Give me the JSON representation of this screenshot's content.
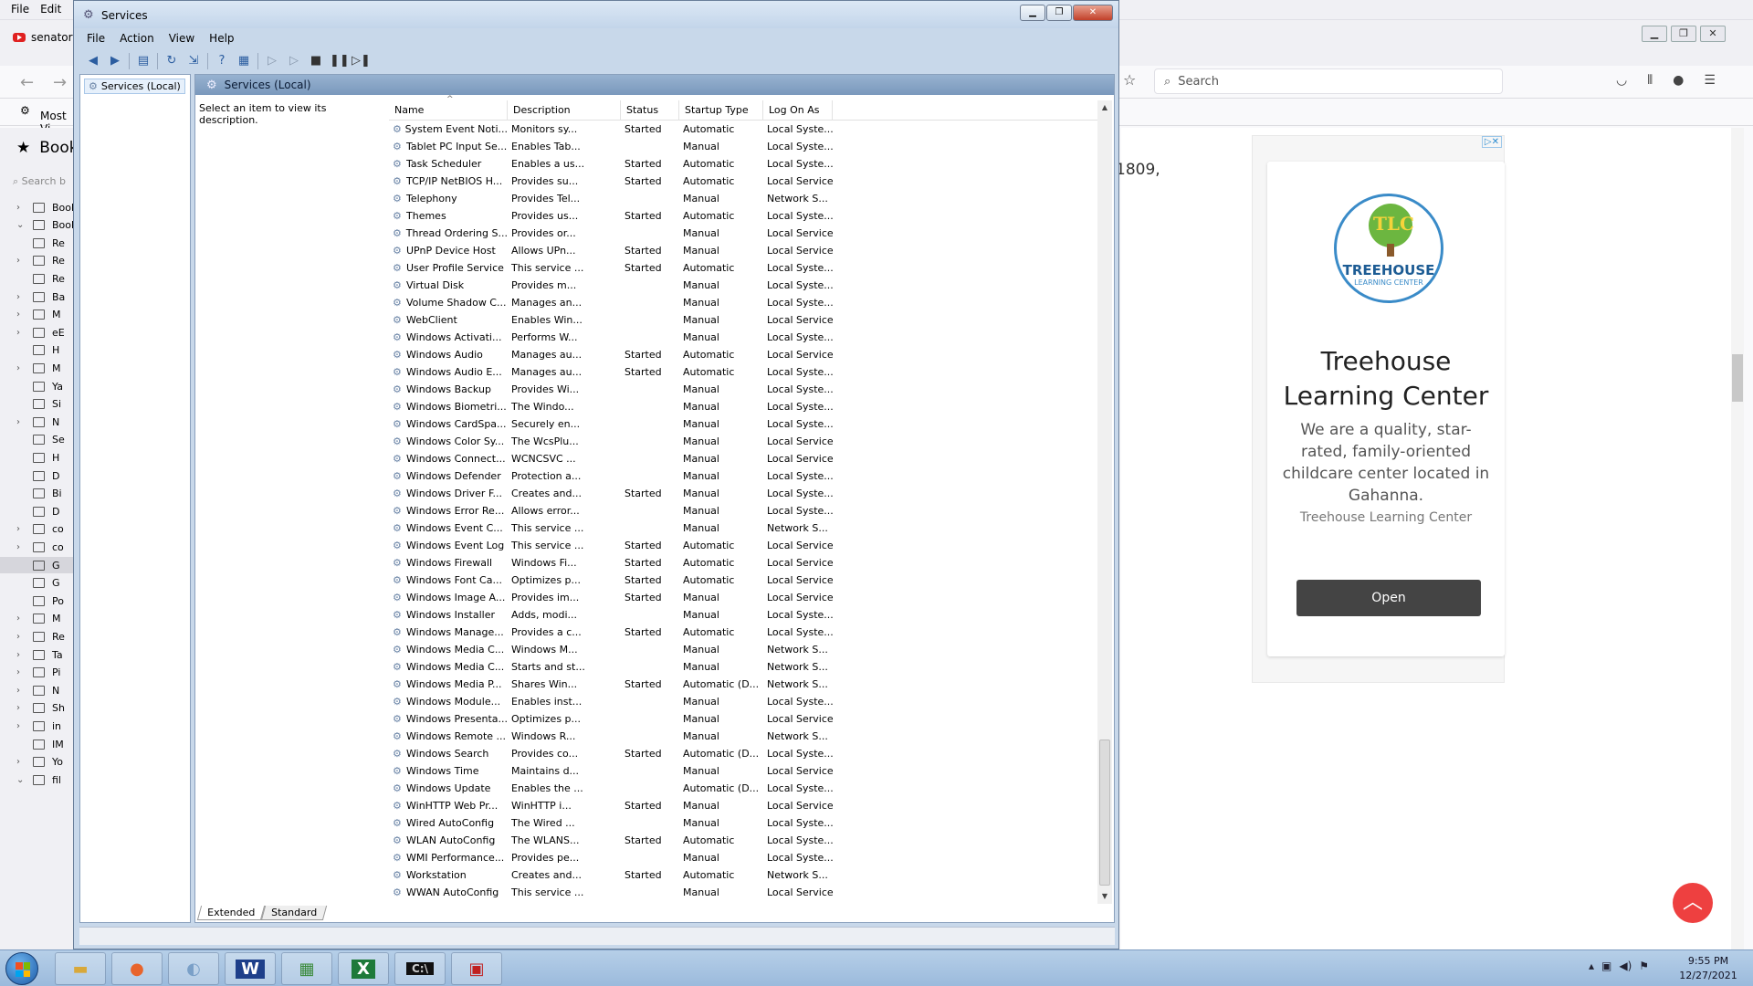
{
  "browser": {
    "menu": [
      "File",
      "Edit"
    ],
    "tab_title": "senator",
    "search_placeholder": "Search",
    "bookmarks_bar_label": "Most Vi",
    "sidebar_title": "Book",
    "sidebar_search": "Search b",
    "sidebar_rows": [
      {
        "label": "Book",
        "tw": "›"
      },
      {
        "label": "Book",
        "tw": "⌄"
      },
      {
        "label": "Re",
        "tw": ""
      },
      {
        "label": "Re",
        "tw": "›"
      },
      {
        "label": "Re",
        "tw": ""
      },
      {
        "label": "Ba",
        "tw": "›"
      },
      {
        "label": "M",
        "tw": "›"
      },
      {
        "label": "eE",
        "tw": "›"
      },
      {
        "label": "H",
        "tw": ""
      },
      {
        "label": "M",
        "tw": "›"
      },
      {
        "label": "Ya",
        "tw": ""
      },
      {
        "label": "Si",
        "tw": ""
      },
      {
        "label": "N",
        "tw": "›"
      },
      {
        "label": "Se",
        "tw": ""
      },
      {
        "label": "H",
        "tw": ""
      },
      {
        "label": "D",
        "tw": ""
      },
      {
        "label": "Bi",
        "tw": ""
      },
      {
        "label": "D",
        "tw": ""
      },
      {
        "label": "co",
        "tw": "›"
      },
      {
        "label": "co",
        "tw": "›"
      },
      {
        "label": "G",
        "tw": ""
      },
      {
        "label": "G",
        "tw": ""
      },
      {
        "label": "Po",
        "tw": ""
      },
      {
        "label": "M",
        "tw": "›"
      },
      {
        "label": "Re",
        "tw": "›"
      },
      {
        "label": "Ta",
        "tw": "›"
      },
      {
        "label": "Pi",
        "tw": "›"
      },
      {
        "label": "N",
        "tw": "›"
      },
      {
        "label": "Sh",
        "tw": "›"
      },
      {
        "label": "in",
        "tw": "›"
      },
      {
        "label": "IM",
        "tw": ""
      },
      {
        "label": "Yo",
        "tw": "›"
      },
      {
        "label": "fil",
        "tw": "⌄"
      }
    ],
    "page_snippet": "1809,",
    "ad": {
      "badge": "▷✕",
      "logo_initials": "TLC",
      "logo_title": "TREEHOUSE",
      "logo_subtitle": "LEARNING CENTER",
      "headline": "Treehouse Learning Center",
      "description": "We are a quality, star-rated, family-oriented childcare center located in Gahanna.",
      "brand": "Treehouse Learning Center",
      "button": "Open"
    }
  },
  "services": {
    "title": "Services",
    "menu": [
      "File",
      "Action",
      "View",
      "Help"
    ],
    "tree_node": "Services (Local)",
    "header": "Services (Local)",
    "description_prompt": "Select an item to view its description.",
    "columns": [
      "Name",
      "Description",
      "Status",
      "Startup Type",
      "Log On As"
    ],
    "rows": [
      [
        "System Event Noti...",
        "Monitors sy...",
        "Started",
        "Automatic",
        "Local Syste..."
      ],
      [
        "Tablet PC Input Se...",
        "Enables Tab...",
        "",
        "Manual",
        "Local Syste..."
      ],
      [
        "Task Scheduler",
        "Enables a us...",
        "Started",
        "Automatic",
        "Local Syste..."
      ],
      [
        "TCP/IP NetBIOS H...",
        "Provides su...",
        "Started",
        "Automatic",
        "Local Service"
      ],
      [
        "Telephony",
        "Provides Tel...",
        "",
        "Manual",
        "Network S..."
      ],
      [
        "Themes",
        "Provides us...",
        "Started",
        "Automatic",
        "Local Syste..."
      ],
      [
        "Thread Ordering S...",
        "Provides or...",
        "",
        "Manual",
        "Local Service"
      ],
      [
        "UPnP Device Host",
        "Allows UPn...",
        "Started",
        "Manual",
        "Local Service"
      ],
      [
        "User Profile Service",
        "This service ...",
        "Started",
        "Automatic",
        "Local Syste..."
      ],
      [
        "Virtual Disk",
        "Provides m...",
        "",
        "Manual",
        "Local Syste..."
      ],
      [
        "Volume Shadow C...",
        "Manages an...",
        "",
        "Manual",
        "Local Syste..."
      ],
      [
        "WebClient",
        "Enables Win...",
        "",
        "Manual",
        "Local Service"
      ],
      [
        "Windows Activati...",
        "Performs W...",
        "",
        "Manual",
        "Local Syste..."
      ],
      [
        "Windows Audio",
        "Manages au...",
        "Started",
        "Automatic",
        "Local Service"
      ],
      [
        "Windows Audio E...",
        "Manages au...",
        "Started",
        "Automatic",
        "Local Syste..."
      ],
      [
        "Windows Backup",
        "Provides Wi...",
        "",
        "Manual",
        "Local Syste..."
      ],
      [
        "Windows Biometri...",
        "The Windo...",
        "",
        "Manual",
        "Local Syste..."
      ],
      [
        "Windows CardSpa...",
        "Securely en...",
        "",
        "Manual",
        "Local Syste..."
      ],
      [
        "Windows Color Sy...",
        "The WcsPlu...",
        "",
        "Manual",
        "Local Service"
      ],
      [
        "Windows Connect...",
        "WCNCSVC ...",
        "",
        "Manual",
        "Local Service"
      ],
      [
        "Windows Defender",
        "Protection a...",
        "",
        "Manual",
        "Local Syste..."
      ],
      [
        "Windows Driver F...",
        "Creates and...",
        "Started",
        "Manual",
        "Local Syste..."
      ],
      [
        "Windows Error Re...",
        "Allows error...",
        "",
        "Manual",
        "Local Syste..."
      ],
      [
        "Windows Event C...",
        "This service ...",
        "",
        "Manual",
        "Network S..."
      ],
      [
        "Windows Event Log",
        "This service ...",
        "Started",
        "Automatic",
        "Local Service"
      ],
      [
        "Windows Firewall",
        "Windows Fi...",
        "Started",
        "Automatic",
        "Local Service"
      ],
      [
        "Windows Font Ca...",
        "Optimizes p...",
        "Started",
        "Automatic",
        "Local Service"
      ],
      [
        "Windows Image A...",
        "Provides im...",
        "Started",
        "Manual",
        "Local Service"
      ],
      [
        "Windows Installer",
        "Adds, modi...",
        "",
        "Manual",
        "Local Syste..."
      ],
      [
        "Windows Manage...",
        "Provides a c...",
        "Started",
        "Automatic",
        "Local Syste..."
      ],
      [
        "Windows Media C...",
        "Windows M...",
        "",
        "Manual",
        "Network S..."
      ],
      [
        "Windows Media C...",
        "Starts and st...",
        "",
        "Manual",
        "Network S..."
      ],
      [
        "Windows Media P...",
        "Shares Win...",
        "Started",
        "Automatic (D...",
        "Network S..."
      ],
      [
        "Windows Module...",
        "Enables inst...",
        "",
        "Manual",
        "Local Syste..."
      ],
      [
        "Windows Presenta...",
        "Optimizes p...",
        "",
        "Manual",
        "Local Service"
      ],
      [
        "Windows Remote ...",
        "Windows R...",
        "",
        "Manual",
        "Network S..."
      ],
      [
        "Windows Search",
        "Provides co...",
        "Started",
        "Automatic (D...",
        "Local Syste..."
      ],
      [
        "Windows Time",
        "Maintains d...",
        "",
        "Manual",
        "Local Service"
      ],
      [
        "Windows Update",
        "Enables the ...",
        "",
        "Automatic (D...",
        "Local Syste..."
      ],
      [
        "WinHTTP Web Pr...",
        "WinHTTP i...",
        "Started",
        "Manual",
        "Local Service"
      ],
      [
        "Wired AutoConfig",
        "The Wired ...",
        "",
        "Manual",
        "Local Syste..."
      ],
      [
        "WLAN AutoConfig",
        "The WLANS...",
        "Started",
        "Automatic",
        "Local Syste..."
      ],
      [
        "WMI Performance...",
        "Provides pe...",
        "",
        "Manual",
        "Local Syste..."
      ],
      [
        "Workstation",
        "Creates and...",
        "Started",
        "Automatic",
        "Network S..."
      ],
      [
        "WWAN AutoConfig",
        "This service ...",
        "",
        "Manual",
        "Local Service"
      ]
    ],
    "tabs": [
      "Extended",
      "Standard"
    ]
  },
  "taskbar": {
    "apps": [
      "firefox",
      "paint",
      "W",
      "network-app",
      "excel",
      "cmd",
      "toolbox"
    ],
    "time": "9:55 PM",
    "date": "12/27/2021"
  }
}
